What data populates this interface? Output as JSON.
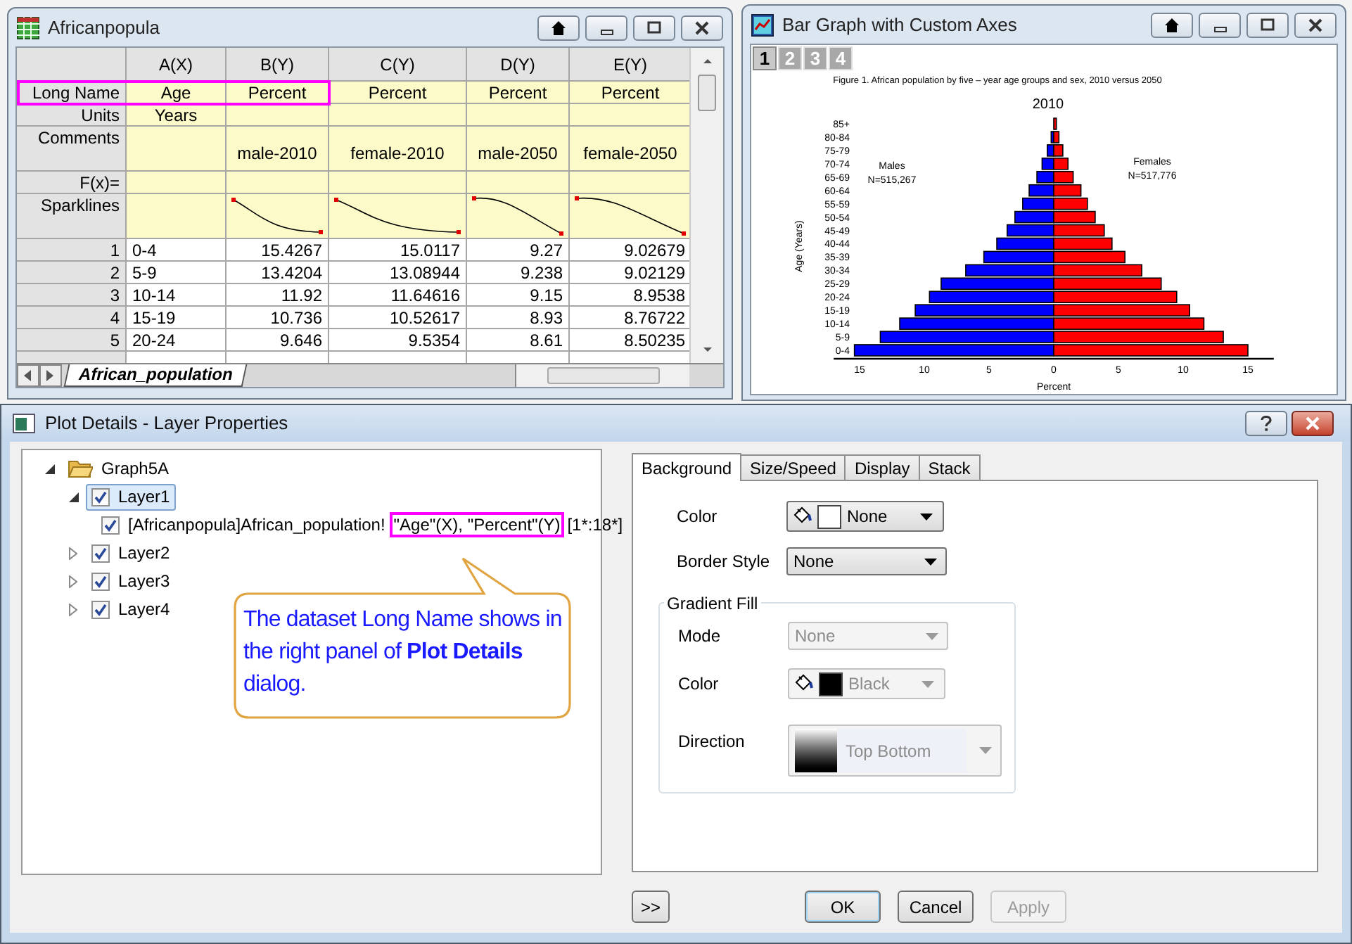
{
  "worksheet_window": {
    "title": "Africanpopula",
    "columns": [
      {
        "header": "A(X)",
        "long_name": "Age",
        "units": "Years",
        "sparkline": false
      },
      {
        "header": "B(Y)",
        "long_name": "Percent",
        "comments": "male-2010",
        "sparkline": true
      },
      {
        "header": "C(Y)",
        "long_name": "Percent",
        "comments": "female-2010",
        "sparkline": true
      },
      {
        "header": "D(Y)",
        "long_name": "Percent",
        "comments": "male-2050",
        "sparkline": true
      },
      {
        "header": "E(Y)",
        "long_name": "Percent",
        "comments": "female-2050",
        "sparkline": true
      }
    ],
    "meta_rows": [
      {
        "label": "Long Name",
        "kind": "long_name"
      },
      {
        "label": "Units",
        "kind": "units"
      },
      {
        "label": "Comments",
        "kind": "comments"
      },
      {
        "label": "F(x)=",
        "kind": "formula"
      },
      {
        "label": "Sparklines",
        "kind": "sparklines"
      }
    ],
    "rows": [
      {
        "index": "1",
        "cells": [
          "0-4",
          "15.4267",
          "15.0117",
          "9.27",
          "9.02679"
        ]
      },
      {
        "index": "2",
        "cells": [
          "5-9",
          "13.4204",
          "13.08944",
          "9.238",
          "9.02129"
        ]
      },
      {
        "index": "3",
        "cells": [
          "10-14",
          "11.92",
          "11.64616",
          "9.15",
          "8.9538"
        ]
      },
      {
        "index": "4",
        "cells": [
          "15-19",
          "10.736",
          "10.52617",
          "8.93",
          "8.76722"
        ]
      },
      {
        "index": "5",
        "cells": [
          "20-24",
          "9.646",
          "9.5354",
          "8.61",
          "8.50235"
        ]
      }
    ],
    "sheet_tab": "African_population"
  },
  "graph_window": {
    "title": "Bar Graph with Custom Axes",
    "layers": [
      {
        "label": "1",
        "selected": true
      },
      {
        "label": "2",
        "selected": false
      },
      {
        "label": "3",
        "selected": false
      },
      {
        "label": "4",
        "selected": false
      }
    ],
    "caption": "Figure 1. African population by five – year age groups and sex, 2010 versus 2050",
    "chart_data": {
      "type": "bar",
      "orientation": "horizontal",
      "title": "2010",
      "xlabel": "Percent",
      "ylabel": "Age (Years)",
      "categories": [
        "85+",
        "80-84",
        "75-79",
        "70-74",
        "65-69",
        "60-64",
        "55-59",
        "50-54",
        "45-49",
        "40-44",
        "35-39",
        "30-34",
        "25-29",
        "20-24",
        "15-19",
        "10-14",
        "5-9",
        "0-4"
      ],
      "stacked": true,
      "series": [
        {
          "color": "#0000ff",
          "values": [
            null,
            -0.2,
            -0.5,
            -0.9,
            -1.3,
            -1.9,
            -2.4,
            -3,
            -3.6,
            -4.4,
            -5.4,
            -6.8,
            -8.7,
            -9.6,
            -10.7,
            -11.9,
            -13.4,
            -15.4
          ]
        },
        {
          "color": "#ff0000",
          "values": [
            0.2,
            0.4,
            0.7,
            1.1,
            1.5,
            2.1,
            2.6,
            3.2,
            3.9,
            4.5,
            5.5,
            6.8,
            8.3,
            9.5,
            10.5,
            11.6,
            13.1,
            15
          ]
        }
      ],
      "xlim": [
        -17,
        17
      ],
      "xticks": [
        {
          "value": -15,
          "label": "15"
        },
        {
          "value": -10,
          "label": "10"
        },
        {
          "value": -5,
          "label": "5"
        },
        0,
        5,
        10,
        15
      ],
      "annotations": [
        {
          "text": "Males"
        },
        {
          "text": "N=515,267"
        },
        {
          "text": "Females"
        },
        {
          "text": "N=517,776"
        }
      ]
    }
  },
  "dialog": {
    "title": "Plot Details - Layer Properties",
    "tree": [
      {
        "label": "Graph5A",
        "kind": "folder",
        "expanded": true,
        "children": [
          {
            "label": "Layer1",
            "kind": "layer",
            "checked": true,
            "selected": true,
            "expanded": true,
            "children": [
              {
                "label": "[Africanpopula]African_population!",
                "highlight": "\"Age\"(X), \"Percent\"(Y)",
                "label_after": "[1*:18*]",
                "kind": "dataset",
                "checked": true,
                "selected": false
              }
            ]
          },
          {
            "label": "Layer2",
            "kind": "layer",
            "checked": true,
            "selected": false,
            "expanded": false
          },
          {
            "label": "Layer3",
            "kind": "layer",
            "checked": true,
            "selected": false,
            "expanded": false
          },
          {
            "label": "Layer4",
            "kind": "layer",
            "checked": true,
            "selected": false,
            "expanded": false
          }
        ]
      }
    ],
    "callout": "The dataset Long Name shows in the right panel of **Plot Details** dialog.",
    "tabs": [
      {
        "label": "Background",
        "selected": true
      },
      {
        "label": "Size/Speed",
        "selected": false
      },
      {
        "label": "Display",
        "selected": false
      },
      {
        "label": "Stack",
        "selected": false
      }
    ],
    "fields": [
      {
        "kind": "color",
        "label": "Color",
        "value": "None",
        "color": "#ffffff",
        "disabled": false
      },
      {
        "kind": "dropdown",
        "label": "Border Style",
        "value": "None",
        "disabled": false
      }
    ],
    "group": {
      "title": "Gradient Fill",
      "fields": [
        {
          "kind": "dropdown",
          "label": "Mode",
          "value": "None",
          "disabled": true
        },
        {
          "kind": "color",
          "label": "Color",
          "value": "Black",
          "color": "#000000",
          "disabled": true
        },
        {
          "kind": "direction",
          "label": "Direction",
          "value": "Top Bottom",
          "disabled": true
        }
      ]
    },
    "buttons": [
      {
        "label": ">>",
        "kind": "more",
        "disabled": false
      },
      {
        "label": "OK",
        "kind": "default",
        "disabled": false
      },
      {
        "label": "Cancel",
        "kind": "normal",
        "disabled": false
      },
      {
        "label": "Apply",
        "kind": "normal",
        "disabled": true
      }
    ]
  }
}
